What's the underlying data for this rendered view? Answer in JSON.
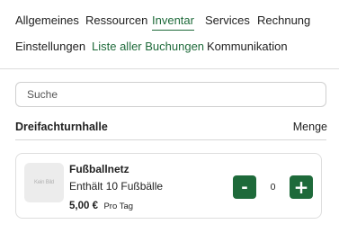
{
  "nav": {
    "row1": [
      "Allgemeines",
      "Ressourcen",
      "Inventar",
      "Services",
      "Rechnung"
    ],
    "row2": [
      "Einstellungen",
      "Liste aller Buchungen",
      "Kommunikation"
    ],
    "active_tab": "Inventar"
  },
  "search": {
    "placeholder": "Suche",
    "value": ""
  },
  "section": {
    "title": "Dreifachturnhalle",
    "quantity_header": "Menge"
  },
  "items": [
    {
      "thumbnail_text": "Kein Bild",
      "name": "Fußballnetz",
      "description": "Enthält 10 Fußbälle",
      "price": "5,00 €",
      "unit": "Pro Tag",
      "quantity": "0",
      "minus_label": "-",
      "plus_label": "+"
    }
  ],
  "colors": {
    "accent": "#1e6a3a",
    "border": "#dedede",
    "thumb_bg": "#ececec"
  }
}
